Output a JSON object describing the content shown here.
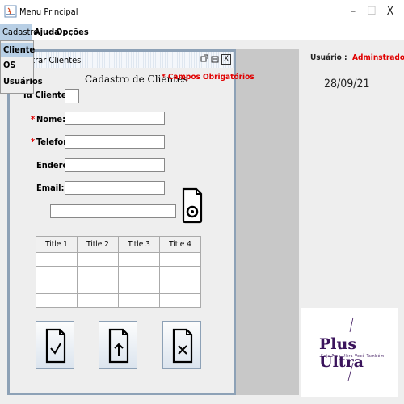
{
  "window": {
    "title": "Menu Principal",
    "min_glyph": "–",
    "max_glyph": "☐",
    "close_glyph": "X"
  },
  "menubar": {
    "items": [
      "Cadastro",
      "Ajuda",
      "Opções"
    ]
  },
  "dropdown": {
    "items": [
      "Cliente",
      "OS",
      "Usuários"
    ]
  },
  "internal_frame": {
    "title": "astrar Clientes",
    "close_glyph": "X"
  },
  "form": {
    "heading": "Cadastro de Clientes",
    "required_note": "* Campos Obrigatórios",
    "labels": {
      "id": "Id Cliente:",
      "name": "Nome:",
      "phone": "Telefone:",
      "address": "Endereço:",
      "email": "Email:"
    },
    "required_mark": "*",
    "values": {
      "id": "",
      "name": "",
      "phone": "",
      "address": "",
      "email": "",
      "search": ""
    }
  },
  "table": {
    "headers": [
      "Title 1",
      "Title 2",
      "Title 3",
      "Title 4"
    ],
    "rows": 4
  },
  "status": {
    "user_label": "Usuário :",
    "user_value": "Adminstrador",
    "date": "28/09/21"
  },
  "logo": {
    "title": "Plus Ultra",
    "subtitle": "Seja Plus Ultra Você Também"
  },
  "colors": {
    "accent_red": "#e00000",
    "selection_blue": "#b8cfe5",
    "frame_border": "#8da1b6",
    "logo_purple": "#3b145c"
  }
}
